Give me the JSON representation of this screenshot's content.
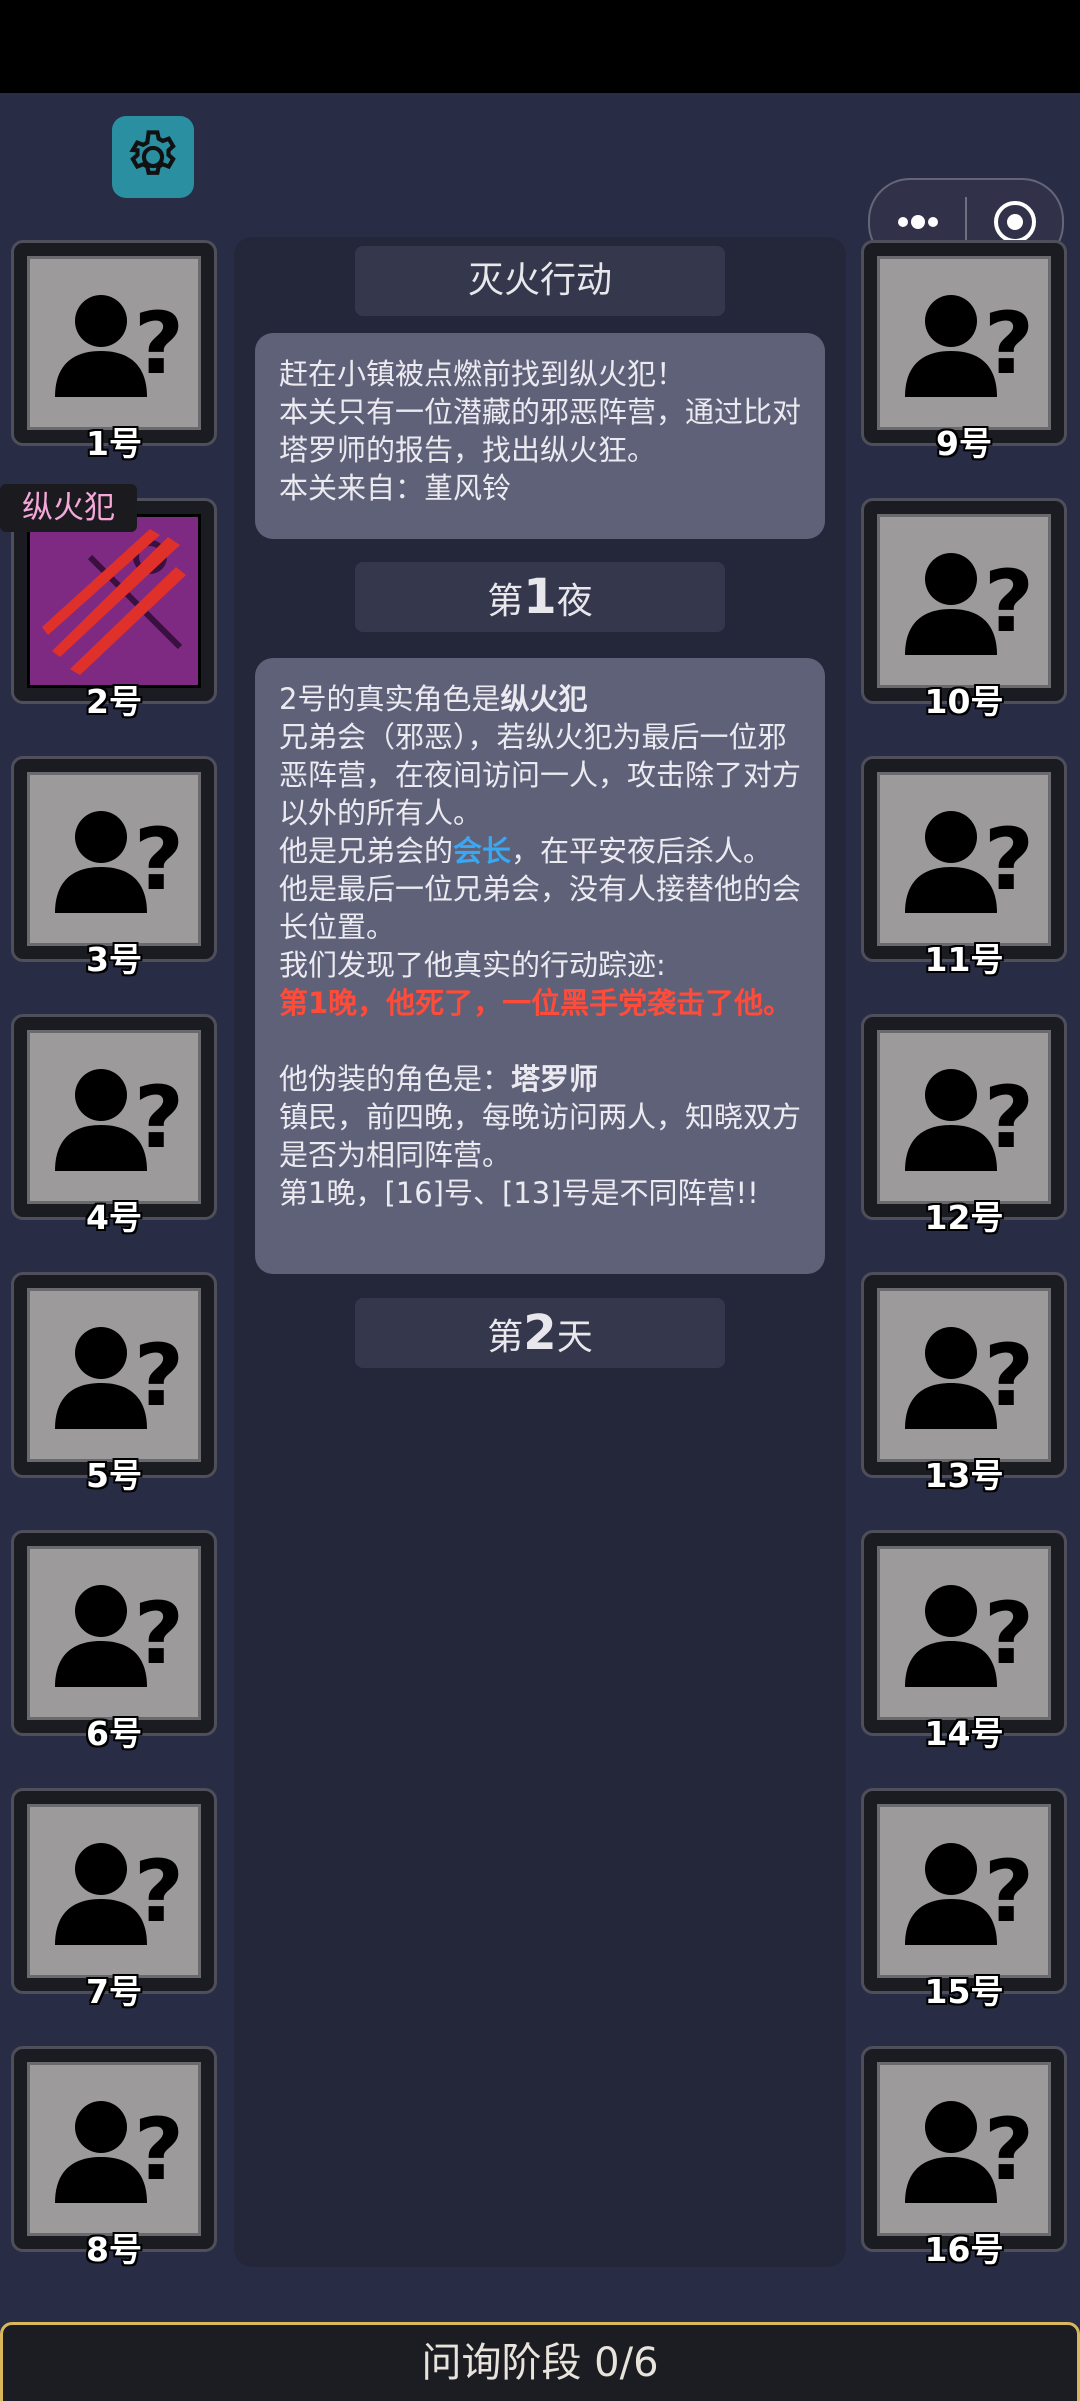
{
  "colors": {
    "background": "#292c45",
    "panel": "#242739",
    "message": "#5e6178",
    "accent_red": "#ff4b3a",
    "accent_blue": "#3aa7f0",
    "role_tag": "#f4a7d8"
  },
  "icons": {
    "settings": "gear-icon",
    "more": "more-dots-icon",
    "close": "target-close-icon",
    "unknown_player": "unknown-person-icon",
    "arsonist": "claw-scratch-icon"
  },
  "left_players": [
    {
      "label": "1号",
      "revealed": false
    },
    {
      "label": "2号",
      "revealed": true,
      "role_tag": "纵火犯"
    },
    {
      "label": "3号",
      "revealed": false
    },
    {
      "label": "4号",
      "revealed": false
    },
    {
      "label": "5号",
      "revealed": false
    },
    {
      "label": "6号",
      "revealed": false
    },
    {
      "label": "7号",
      "revealed": false
    },
    {
      "label": "8号",
      "revealed": false
    }
  ],
  "right_players": [
    {
      "label": "9号"
    },
    {
      "label": "10号"
    },
    {
      "label": "11号"
    },
    {
      "label": "12号"
    },
    {
      "label": "13号"
    },
    {
      "label": "14号"
    },
    {
      "label": "15号"
    },
    {
      "label": "16号"
    }
  ],
  "level": {
    "title": "灭火行动",
    "intro": [
      "赶在小镇被点燃前找到纵火犯！",
      "本关只有一位潜藏的邪恶阵营，通过比对塔罗师的报告，找出纵火狂。",
      "本关来自：堇风铃"
    ]
  },
  "night1": {
    "prefix": "第",
    "number": "1",
    "suffix": "夜",
    "line1_a": "2号的真实角色是",
    "line1_b": "纵火犯",
    "line2": "兄弟会（邪恶），若纵火犯为最后一位邪恶阵营，在夜间访问一人，攻击除了对方以外的所有人。",
    "line3_a": "他是兄弟会的",
    "line3_b": "会长",
    "line3_c": "，在平安夜后杀人。他是最后一位兄弟会，没有人接替他的会长位置。",
    "line4": "我们发现了他真实的行动踪迹:",
    "line5": "第1晚，他死了，一位黑手党袭击了他。",
    "line6_a": "他伪装的角色是：",
    "line6_b": "塔罗师",
    "line7": "镇民，前四晚，每晚访问两人，知晓双方是否为相同阵营。",
    "line8": "第1晚，[16]号、[13]号是不同阵营!!"
  },
  "day2": {
    "prefix": "第",
    "number": "2",
    "suffix": "天"
  },
  "phase": {
    "label": "问询阶段 0/6"
  }
}
